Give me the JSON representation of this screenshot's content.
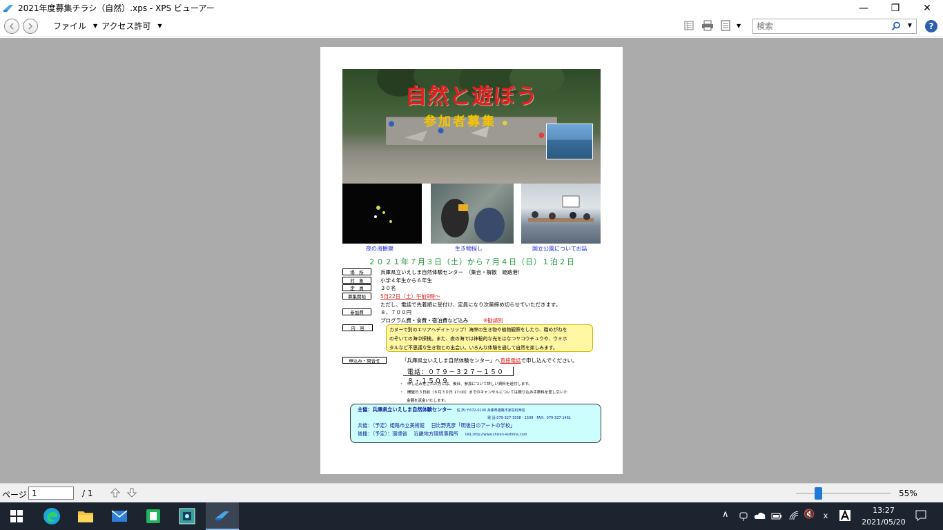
{
  "window": {
    "title": "2021年度募集チラシ（自然）.xps - XPS ビューアー",
    "minimize_glyph": "—",
    "maximize_glyph": "❐",
    "close_glyph": "✕"
  },
  "toolbar": {
    "file_menu": "ファイル",
    "access_menu": "アクセス許可",
    "search_placeholder": "検索",
    "help_glyph": "?",
    "icons": [
      "back-icon",
      "forward-icon",
      "document-outline-icon",
      "print-icon",
      "page-view-icon",
      "search-icon",
      "help-icon"
    ]
  },
  "flyer": {
    "title": "自然と遊ぼう",
    "subtitle": "参加者募集",
    "captions": [
      "夜の海観察",
      "生き物探し",
      "国立公園についてお話"
    ],
    "date_line": "２０２１年７月３日（土）から７月４日（日）１泊２日",
    "rows": [
      {
        "label": "場　所",
        "value": "兵庫県立いえしま自然体験センター　（集合・解散　姫路港）"
      },
      {
        "label": "対　象",
        "value": "小学４年生から６年生"
      },
      {
        "label": "定　員",
        "value": "３０名"
      },
      {
        "label": "募集開始",
        "value": "5月22日（土）午前9時～"
      }
    ],
    "note_first_come": "ただし、電話で先着順に受付け、定員になり次第締め切らせていただきます。",
    "fee_label": "参加費",
    "fee_value": "８，７００円",
    "fee_detail": "プログラム費・食費・宿泊費など込み",
    "fee_note": "※勧請別",
    "content_label": "内　容",
    "content_lines": [
      "カヌーで別のエリアへデイトリップ！海岸の生き物や植物観察をしたり、磯めがねを",
      "のぞいての海中探検。また、夜の海では神秘的な光をはなつヤコウチュウや、ウミホ",
      "タルなど不思議な生き物との出会い。いろんな体験を通して自然を楽しみます。"
    ],
    "apply_label": "申込み・問合せ",
    "apply_text_1": "「兵庫県立いえしま自然体験センター」へ",
    "apply_text_red": "直接電話",
    "apply_text_2": "で申し込んでください。",
    "phone": "電話：０７９－３２７－１５０８・１５０９",
    "notes": [
      "申し込みをされた方には、後日、参加について詳しい資料を送付します。",
      "開催日３日前（６月３０日 17:00）までのキャンセルについては振り込み手数料を差し引いた",
      "金額を返金いたします。"
    ],
    "sponsor_main": "主催：兵庫県立いえしま自然体験センター",
    "sponsor_addr_1": "住 所:〒672-0100 兵庫県姫路市家島町西島",
    "sponsor_addr_2": "電 話:079-327-1508・1509　FAX：079-327-1461",
    "cosponsor": "共催：（予定）姫路市立美術館　 日比野克彦「明後日のアートの学校」",
    "support": "後援：（予定）：環境省　 近畿地方環境事務所",
    "url": "URL:http://www.shizen-ieshima.com"
  },
  "statusbar": {
    "page_label": "ページ",
    "page_value": "1",
    "page_total": "/ 1",
    "zoom": "55%",
    "zoom_fraction": 0.55
  },
  "taskbar": {
    "apps": [
      "start-icon",
      "edge-icon",
      "file-explorer-icon",
      "mail-icon",
      "notes-icon",
      "remote-app-icon",
      "xps-viewer-icon"
    ],
    "time": "13:27",
    "date": "2021/05/20"
  }
}
